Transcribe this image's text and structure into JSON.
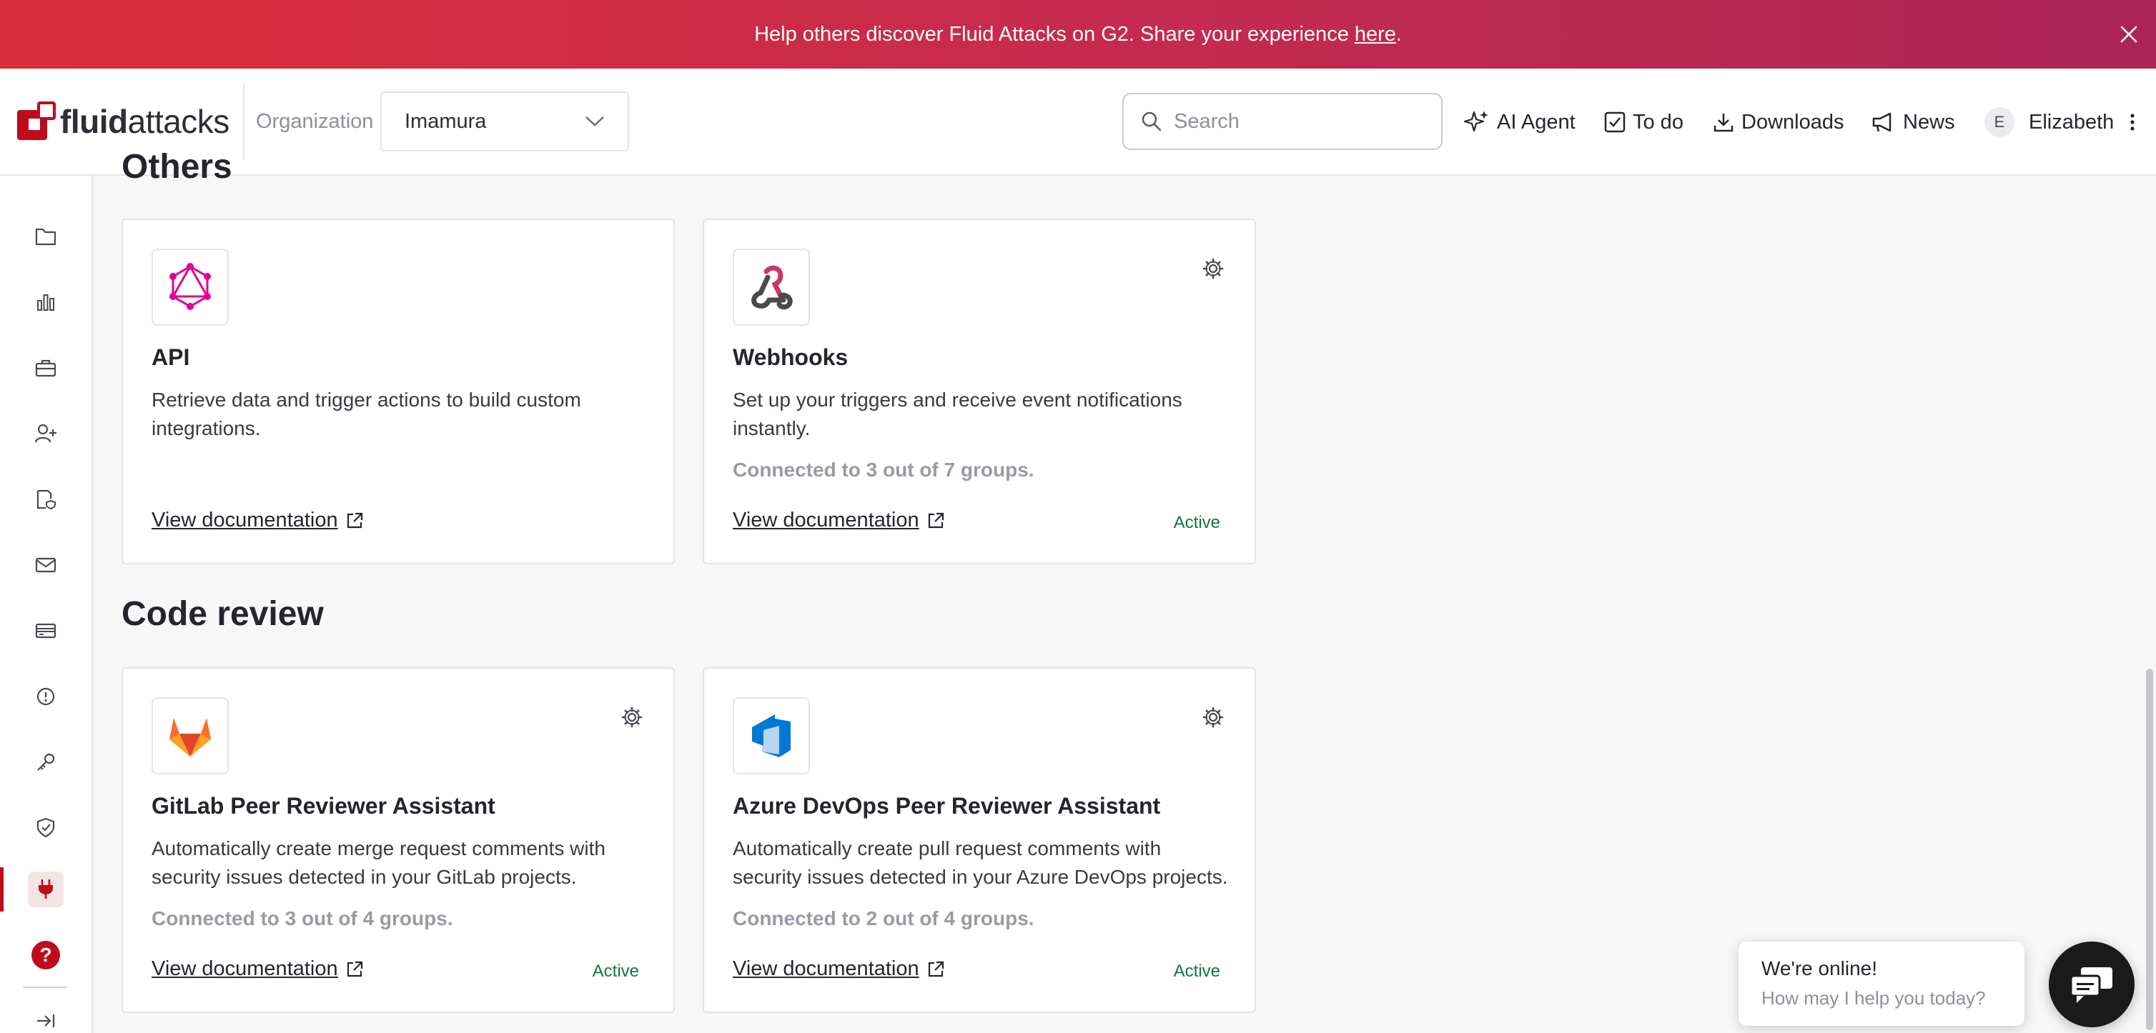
{
  "banner": {
    "text": "Help others discover Fluid Attacks on G2. Share your experience",
    "link_text": "here",
    "suffix": "."
  },
  "header": {
    "logo_bold": "fluid",
    "logo_light": "attacks",
    "org_label": "Organization",
    "org_value": "Imamura",
    "search_placeholder": "Search",
    "nav": {
      "ai_agent": "AI Agent",
      "todo": "To do",
      "downloads": "Downloads",
      "news": "News"
    },
    "user_initial": "E",
    "user_name": "Elizabeth"
  },
  "sections": {
    "others_title": "Others",
    "code_review_title": "Code review"
  },
  "cards": [
    {
      "title": "API",
      "description": "Retrieve data and trigger actions to build custom integrations.",
      "connected": "",
      "doc_link": "View documentation",
      "status": ""
    },
    {
      "title": "Webhooks",
      "description": "Set up your triggers and receive event notifications instantly.",
      "connected": "Connected to 3 out of 7 groups.",
      "doc_link": "View documentation",
      "status": "Active"
    },
    {
      "title": "GitLab Peer Reviewer Assistant",
      "description": "Automatically create merge request comments with security issues detected in your GitLab projects.",
      "connected": "Connected to 3 out of 4 groups.",
      "doc_link": "View documentation",
      "status": "Active"
    },
    {
      "title": "Azure DevOps Peer Reviewer Assistant",
      "description": "Automatically create pull request comments with security issues detected in your Azure DevOps projects.",
      "connected": "Connected to 2 out of 4 groups.",
      "doc_link": "View documentation",
      "status": "Active"
    }
  ],
  "sidebar": {
    "items": [
      "folder-icon",
      "chart-icon",
      "briefcase-icon",
      "user-plus-icon",
      "policy-icon",
      "mail-icon",
      "credit-card-icon",
      "alert-icon",
      "key-icon",
      "shield-check-icon",
      "plug-icon",
      "help-icon",
      "collapse-icon"
    ],
    "help_glyph": "?"
  },
  "chat": {
    "title": "We're online!",
    "subtitle": "How may I help you today?"
  },
  "colors": {
    "brand_red": "#bf0b1a",
    "active_green": "#0b7a3a"
  }
}
